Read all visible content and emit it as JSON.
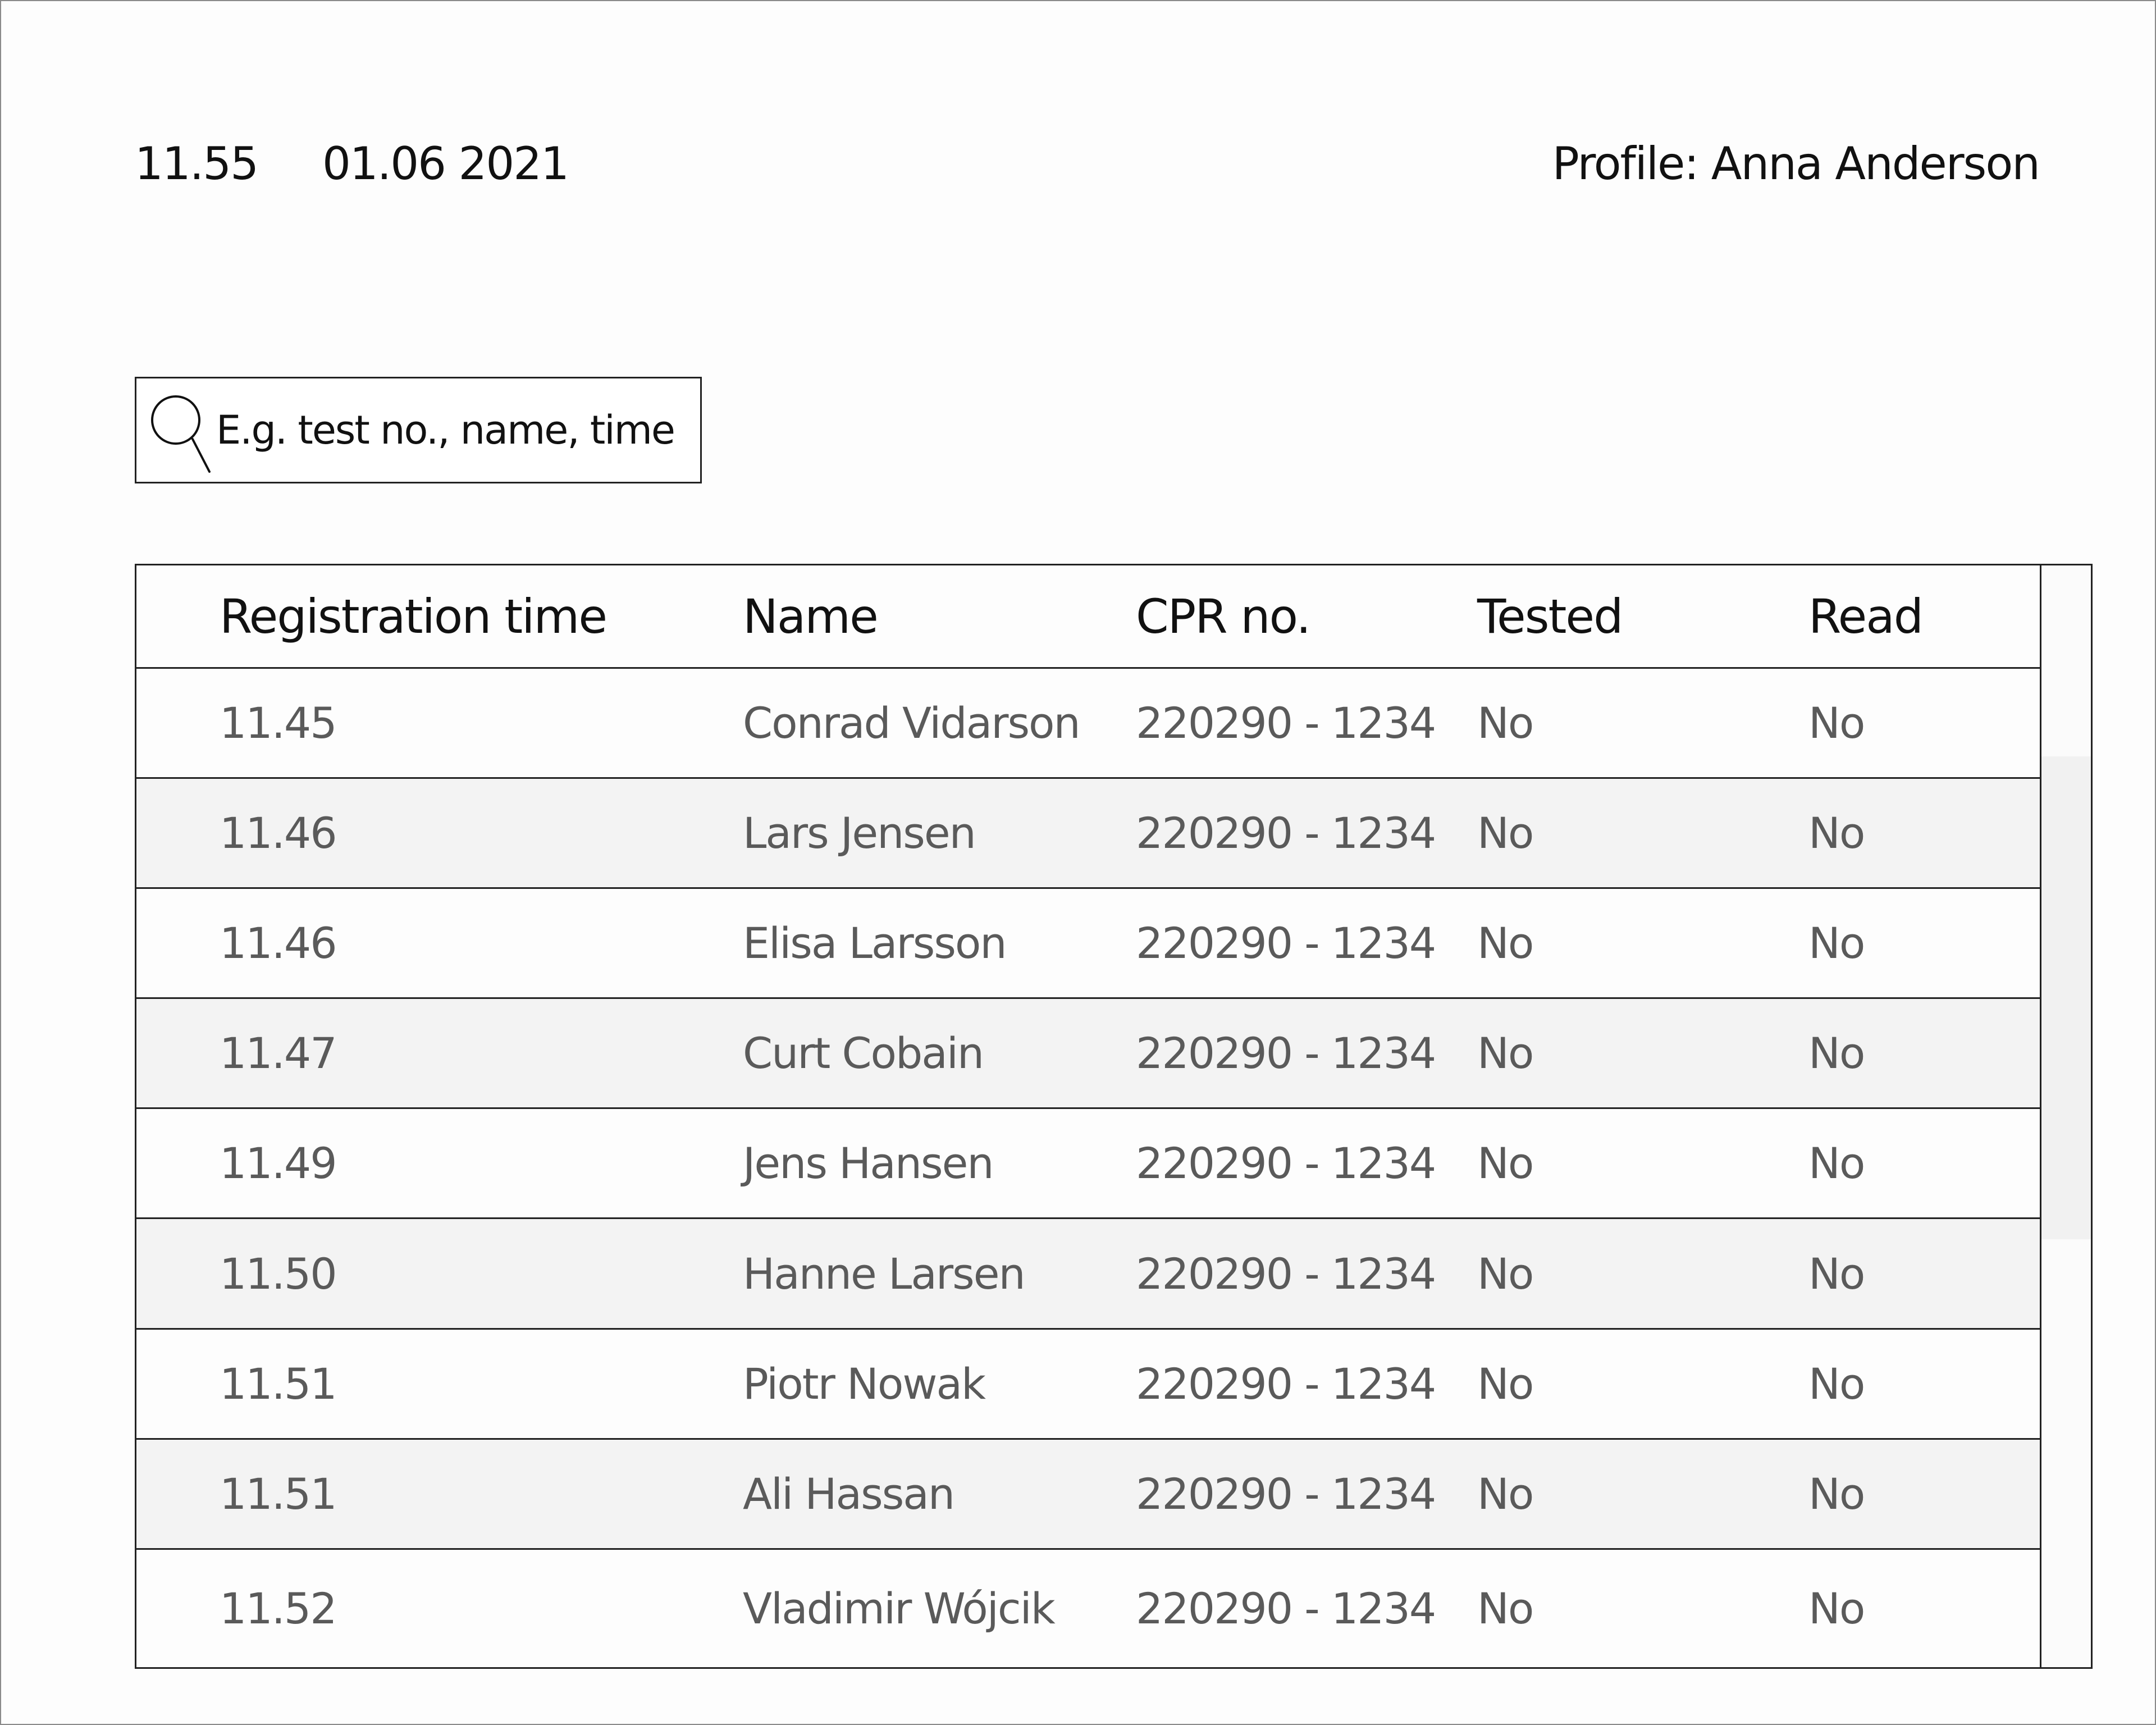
{
  "header": {
    "time": "11.55",
    "date": "01.06 2021",
    "profile": "Profile: Anna Anderson"
  },
  "search": {
    "placeholder": "E.g. test no., name, time",
    "icon": "search-icon"
  },
  "table": {
    "columns": [
      "Registration time",
      "Name",
      "CPR no.",
      "Tested",
      "Read"
    ],
    "rows": [
      [
        "11.45",
        "Conrad Vidarson",
        "220290 - 1234",
        "No",
        "No"
      ],
      [
        "11.46",
        "Lars Jensen",
        "220290 - 1234",
        "No",
        "No"
      ],
      [
        "11.46",
        "Elisa Larsson",
        "220290 - 1234",
        "No",
        "No"
      ],
      [
        "11.47",
        "Curt Cobain",
        "220290 - 1234",
        "No",
        "No"
      ],
      [
        "11.49",
        "Jens Hansen",
        "220290 - 1234",
        "No",
        "No"
      ],
      [
        "11.50",
        "Hanne Larsen",
        "220290 - 1234",
        "No",
        "No"
      ],
      [
        "11.51",
        "Piotr Nowak",
        "220290 - 1234",
        "No",
        "No"
      ],
      [
        "11.51",
        "Ali  Hassan",
        "220290 - 1234",
        "No",
        "No"
      ],
      [
        "11.52",
        "Vladimir Wójcik",
        "220290 - 1234",
        "No",
        "No"
      ]
    ]
  },
  "colors": {
    "border": "#222222",
    "row_alt_bg": "#f3f3f3",
    "cell_text": "#5a5a5a",
    "header_text": "#111111"
  }
}
